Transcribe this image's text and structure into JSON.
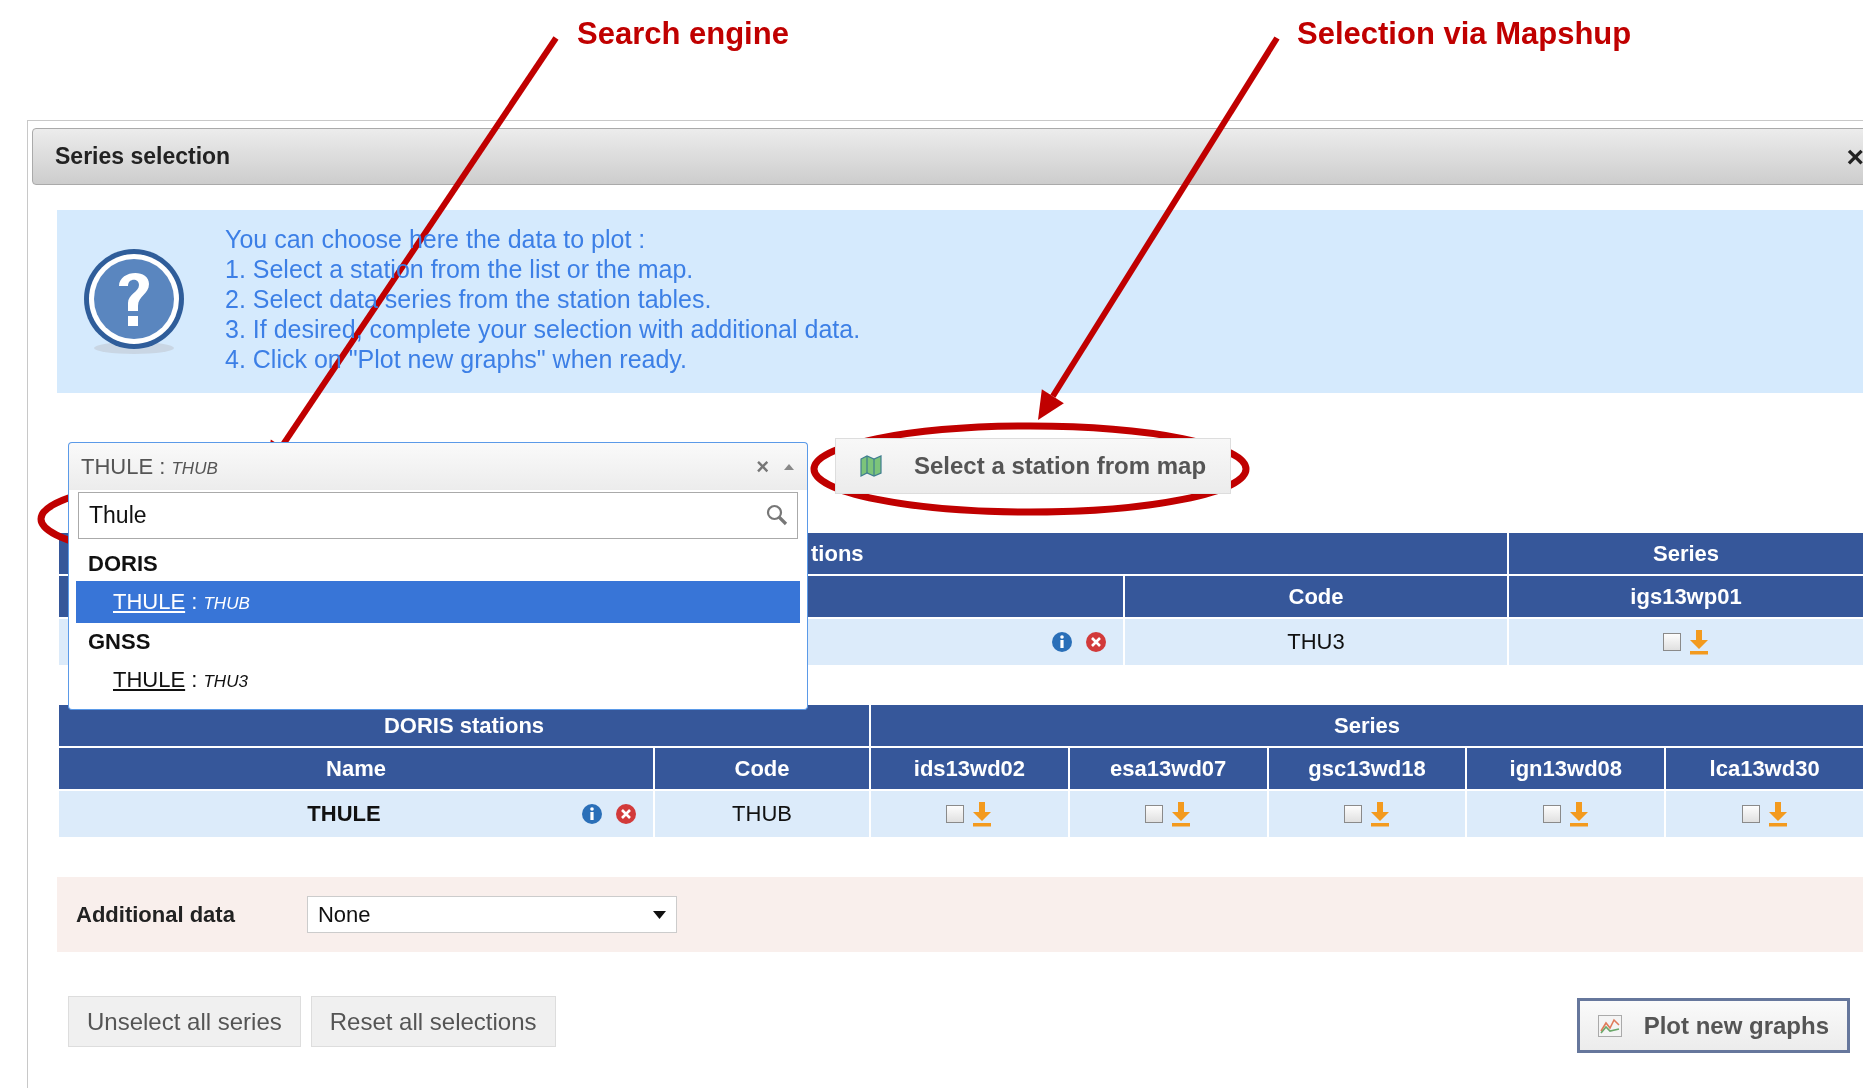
{
  "annotations": [
    {
      "label": "Search engine"
    },
    {
      "label": "Selection via Mapshup"
    }
  ],
  "dialog": {
    "title": "Series selection",
    "close": "×"
  },
  "help": {
    "lines": [
      "You can choose here the data to plot :",
      "1. Select a station from the list or the map.",
      "2. Select data series from the station tables.",
      "3. If desired, complete your selection with additional data.",
      "4. Click on \"Plot new graphs\" when ready."
    ]
  },
  "station_select": {
    "value": "THULE",
    "separator": ":",
    "value_code": "THUB",
    "clear": "×",
    "expanded": true,
    "search": {
      "value": "Thule"
    },
    "groups": [
      {
        "label": "DORIS",
        "options": [
          {
            "name": "THULE",
            "separator": ":",
            "code": "THUB",
            "selected": true
          }
        ]
      },
      {
        "label": "GNSS",
        "options": [
          {
            "name": "THULE",
            "separator": ":",
            "code": "THU3",
            "selected": false
          }
        ]
      }
    ]
  },
  "map_button": {
    "label": "Select a station from map"
  },
  "gnss_table": {
    "title": "tions",
    "series_header": "Series",
    "code_header": "Code",
    "series": [
      "igs13wp01"
    ],
    "rows": [
      {
        "code": "THU3",
        "checked": [
          false
        ]
      }
    ]
  },
  "doris_table": {
    "title": "DORIS stations",
    "series_header": "Series",
    "name_header": "Name",
    "code_header": "Code",
    "series": [
      "ids13wd02",
      "esa13wd07",
      "gsc13wd18",
      "ign13wd08",
      "lca13wd30"
    ],
    "rows": [
      {
        "name": "THULE",
        "code": "THUB",
        "checked": [
          false,
          false,
          false,
          false,
          false
        ]
      }
    ]
  },
  "additional_data": {
    "label": "Additional data",
    "value": "None"
  },
  "buttons": [
    {
      "label": "Unselect all series",
      "kind": "plain"
    },
    {
      "label": "Reset all selections",
      "kind": "plain"
    },
    {
      "label": "Plot new graphs",
      "kind": "primary"
    }
  ]
}
